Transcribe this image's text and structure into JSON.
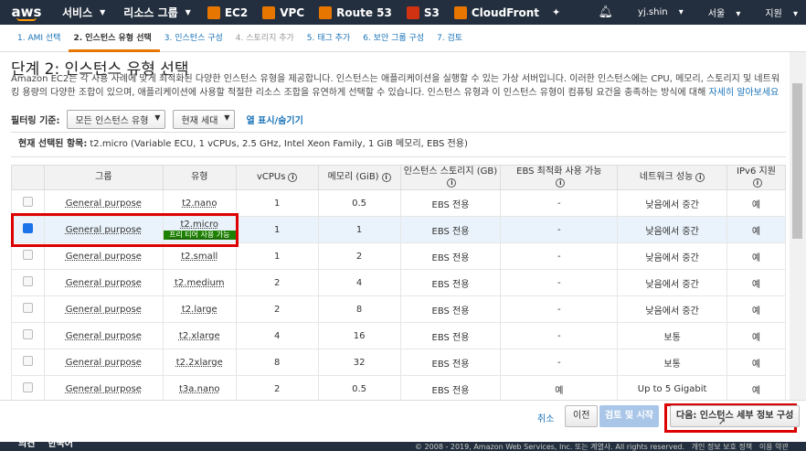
{
  "topnav": {
    "logo": "aws",
    "services": "서비스",
    "resource_groups": "리소스 그룹",
    "pinned": [
      {
        "label": "EC2",
        "color": "#e77600"
      },
      {
        "label": "VPC",
        "color": "#e77600"
      },
      {
        "label": "Route 53",
        "color": "#e77600"
      },
      {
        "label": "S3",
        "color": "#d13212"
      },
      {
        "label": "CloudFront",
        "color": "#e77600"
      }
    ],
    "user": "yj.shin",
    "region": "서울",
    "support": "지원"
  },
  "steps": [
    "1. AMI 선택",
    "2. 인스턴스 유형 선택",
    "3. 인스턴스 구성",
    "4. 스토리지 추가",
    "5. 태그 추가",
    "6. 보안 그룹 구성",
    "7. 검토"
  ],
  "page": {
    "title": "단계 2: 인스턴스 유형 선택",
    "description": "Amazon EC2는 각 사용 사례에 맞게 최적화된 다양한 인스턴스 유형을 제공합니다. 인스턴스는 애플리케이션을 실행할 수 있는 가상 서버입니다. 이러한 인스턴스에는 CPU, 메모리, 스토리지 및 네트워킹 용량의 다양한 조합이 있으며, 애플리케이션에 사용할 적절한 리소스 조합을 유연하게 선택할 수 있습니다. 인스턴스 유형과 이 인스턴스 유형이 컴퓨팅 요건을 충족하는 방식에 대해",
    "learn_more": "자세히 알아보세요"
  },
  "filter": {
    "label": "필터링 기준:",
    "type_select": "모든 인스턴스 유형",
    "gen_select": "현재 세대",
    "toggle_columns": "열 표시/숨기기"
  },
  "current": {
    "label": "현재 선택된 항목:",
    "value": "t2.micro (Variable ECU, 1 vCPUs, 2.5 GHz, Intel Xeon Family, 1 GiB 메모리, EBS 전용)"
  },
  "table": {
    "headers": [
      "그룹",
      "유형",
      "vCPUs",
      "메모리 (GiB)",
      "인스턴스 스토리지 (GB)",
      "EBS 최적화 사용 가능",
      "네트워크 성능",
      "IPv6 지원"
    ],
    "free_tier": "프리 티어 사용 가능",
    "rows": [
      {
        "group": "General purpose",
        "type": "t2.nano",
        "vcpu": "1",
        "mem": "0.5",
        "storage": "EBS 전용",
        "ebs": "-",
        "net": "낮음에서 중간",
        "ipv6": "예",
        "selected": false
      },
      {
        "group": "General purpose",
        "type": "t2.micro",
        "vcpu": "1",
        "mem": "1",
        "storage": "EBS 전용",
        "ebs": "-",
        "net": "낮음에서 중간",
        "ipv6": "예",
        "selected": true
      },
      {
        "group": "General purpose",
        "type": "t2.small",
        "vcpu": "1",
        "mem": "2",
        "storage": "EBS 전용",
        "ebs": "-",
        "net": "낮음에서 중간",
        "ipv6": "예",
        "selected": false
      },
      {
        "group": "General purpose",
        "type": "t2.medium",
        "vcpu": "2",
        "mem": "4",
        "storage": "EBS 전용",
        "ebs": "-",
        "net": "낮음에서 중간",
        "ipv6": "예",
        "selected": false
      },
      {
        "group": "General purpose",
        "type": "t2.large",
        "vcpu": "2",
        "mem": "8",
        "storage": "EBS 전용",
        "ebs": "-",
        "net": "낮음에서 중간",
        "ipv6": "예",
        "selected": false
      },
      {
        "group": "General purpose",
        "type": "t2.xlarge",
        "vcpu": "4",
        "mem": "16",
        "storage": "EBS 전용",
        "ebs": "-",
        "net": "보통",
        "ipv6": "예",
        "selected": false
      },
      {
        "group": "General purpose",
        "type": "t2.2xlarge",
        "vcpu": "8",
        "mem": "32",
        "storage": "EBS 전용",
        "ebs": "-",
        "net": "보통",
        "ipv6": "예",
        "selected": false
      },
      {
        "group": "General purpose",
        "type": "t3a.nano",
        "vcpu": "2",
        "mem": "0.5",
        "storage": "EBS 전용",
        "ebs": "예",
        "net": "Up to 5 Gigabit",
        "ipv6": "예",
        "selected": false
      }
    ]
  },
  "buttons": {
    "cancel": "취소",
    "previous": "이전",
    "review": "검토 및 시작",
    "next": "다음: 인스턴스 세부 정보 구성"
  },
  "footer": {
    "feedback": "의견",
    "language": "한국어",
    "copyright": "© 2008 - 2019, Amazon Web Services, Inc. 또는 계열사. All rights reserved.",
    "privacy": "개인 정보 보호 정책",
    "terms": "이용 약관"
  }
}
